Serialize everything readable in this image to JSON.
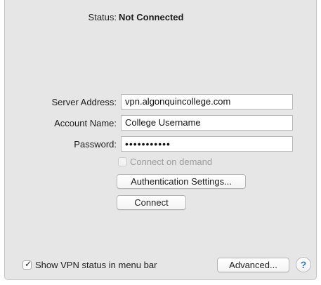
{
  "status": {
    "label": "Status:",
    "value": "Not Connected"
  },
  "form": {
    "server_label": "Server Address:",
    "server_value": "vpn.algonquincollege.com",
    "account_label": "Account Name:",
    "account_value": "College Username",
    "password_label": "Password:",
    "password_masked": "•••••••••••",
    "connect_on_demand_label": "Connect on demand",
    "connect_on_demand_checked": false,
    "connect_on_demand_enabled": false
  },
  "buttons": {
    "auth_settings": "Authentication Settings...",
    "connect": "Connect",
    "advanced": "Advanced...",
    "help": "?"
  },
  "footer": {
    "show_vpn_status_label": "Show VPN status in menu bar",
    "show_vpn_status_checked": true
  },
  "colors": {
    "panel_bg": "#e6e6e6",
    "help_accent": "#3478d4"
  },
  "icons": {
    "help": "help-icon",
    "checkmark": "checkmark-icon"
  }
}
